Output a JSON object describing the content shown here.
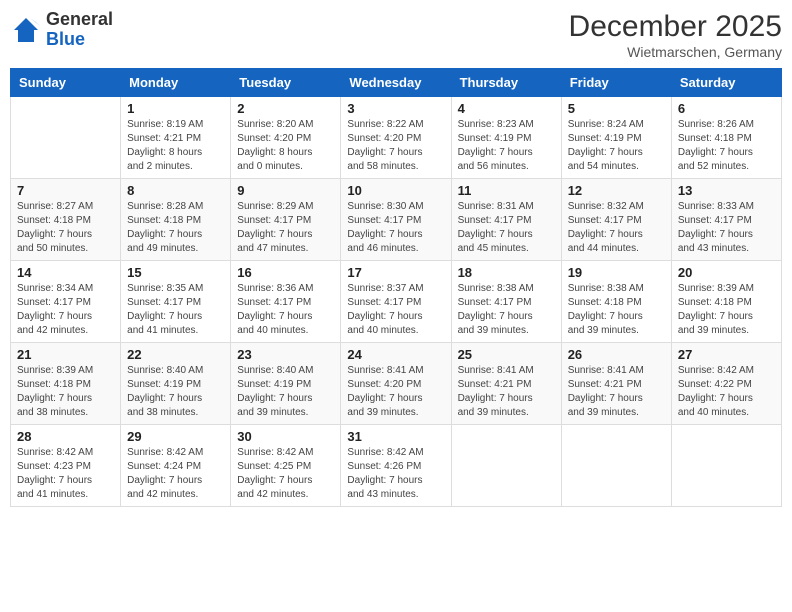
{
  "logo": {
    "general": "General",
    "blue": "Blue"
  },
  "header": {
    "month_year": "December 2025",
    "location": "Wietmarschen, Germany"
  },
  "days_of_week": [
    "Sunday",
    "Monday",
    "Tuesday",
    "Wednesday",
    "Thursday",
    "Friday",
    "Saturday"
  ],
  "weeks": [
    [
      {
        "day": "",
        "info": ""
      },
      {
        "day": "1",
        "info": "Sunrise: 8:19 AM\nSunset: 4:21 PM\nDaylight: 8 hours\nand 2 minutes."
      },
      {
        "day": "2",
        "info": "Sunrise: 8:20 AM\nSunset: 4:20 PM\nDaylight: 8 hours\nand 0 minutes."
      },
      {
        "day": "3",
        "info": "Sunrise: 8:22 AM\nSunset: 4:20 PM\nDaylight: 7 hours\nand 58 minutes."
      },
      {
        "day": "4",
        "info": "Sunrise: 8:23 AM\nSunset: 4:19 PM\nDaylight: 7 hours\nand 56 minutes."
      },
      {
        "day": "5",
        "info": "Sunrise: 8:24 AM\nSunset: 4:19 PM\nDaylight: 7 hours\nand 54 minutes."
      },
      {
        "day": "6",
        "info": "Sunrise: 8:26 AM\nSunset: 4:18 PM\nDaylight: 7 hours\nand 52 minutes."
      }
    ],
    [
      {
        "day": "7",
        "info": "Sunrise: 8:27 AM\nSunset: 4:18 PM\nDaylight: 7 hours\nand 50 minutes."
      },
      {
        "day": "8",
        "info": "Sunrise: 8:28 AM\nSunset: 4:18 PM\nDaylight: 7 hours\nand 49 minutes."
      },
      {
        "day": "9",
        "info": "Sunrise: 8:29 AM\nSunset: 4:17 PM\nDaylight: 7 hours\nand 47 minutes."
      },
      {
        "day": "10",
        "info": "Sunrise: 8:30 AM\nSunset: 4:17 PM\nDaylight: 7 hours\nand 46 minutes."
      },
      {
        "day": "11",
        "info": "Sunrise: 8:31 AM\nSunset: 4:17 PM\nDaylight: 7 hours\nand 45 minutes."
      },
      {
        "day": "12",
        "info": "Sunrise: 8:32 AM\nSunset: 4:17 PM\nDaylight: 7 hours\nand 44 minutes."
      },
      {
        "day": "13",
        "info": "Sunrise: 8:33 AM\nSunset: 4:17 PM\nDaylight: 7 hours\nand 43 minutes."
      }
    ],
    [
      {
        "day": "14",
        "info": "Sunrise: 8:34 AM\nSunset: 4:17 PM\nDaylight: 7 hours\nand 42 minutes."
      },
      {
        "day": "15",
        "info": "Sunrise: 8:35 AM\nSunset: 4:17 PM\nDaylight: 7 hours\nand 41 minutes."
      },
      {
        "day": "16",
        "info": "Sunrise: 8:36 AM\nSunset: 4:17 PM\nDaylight: 7 hours\nand 40 minutes."
      },
      {
        "day": "17",
        "info": "Sunrise: 8:37 AM\nSunset: 4:17 PM\nDaylight: 7 hours\nand 40 minutes."
      },
      {
        "day": "18",
        "info": "Sunrise: 8:38 AM\nSunset: 4:17 PM\nDaylight: 7 hours\nand 39 minutes."
      },
      {
        "day": "19",
        "info": "Sunrise: 8:38 AM\nSunset: 4:18 PM\nDaylight: 7 hours\nand 39 minutes."
      },
      {
        "day": "20",
        "info": "Sunrise: 8:39 AM\nSunset: 4:18 PM\nDaylight: 7 hours\nand 39 minutes."
      }
    ],
    [
      {
        "day": "21",
        "info": "Sunrise: 8:39 AM\nSunset: 4:18 PM\nDaylight: 7 hours\nand 38 minutes."
      },
      {
        "day": "22",
        "info": "Sunrise: 8:40 AM\nSunset: 4:19 PM\nDaylight: 7 hours\nand 38 minutes."
      },
      {
        "day": "23",
        "info": "Sunrise: 8:40 AM\nSunset: 4:19 PM\nDaylight: 7 hours\nand 39 minutes."
      },
      {
        "day": "24",
        "info": "Sunrise: 8:41 AM\nSunset: 4:20 PM\nDaylight: 7 hours\nand 39 minutes."
      },
      {
        "day": "25",
        "info": "Sunrise: 8:41 AM\nSunset: 4:21 PM\nDaylight: 7 hours\nand 39 minutes."
      },
      {
        "day": "26",
        "info": "Sunrise: 8:41 AM\nSunset: 4:21 PM\nDaylight: 7 hours\nand 39 minutes."
      },
      {
        "day": "27",
        "info": "Sunrise: 8:42 AM\nSunset: 4:22 PM\nDaylight: 7 hours\nand 40 minutes."
      }
    ],
    [
      {
        "day": "28",
        "info": "Sunrise: 8:42 AM\nSunset: 4:23 PM\nDaylight: 7 hours\nand 41 minutes."
      },
      {
        "day": "29",
        "info": "Sunrise: 8:42 AM\nSunset: 4:24 PM\nDaylight: 7 hours\nand 42 minutes."
      },
      {
        "day": "30",
        "info": "Sunrise: 8:42 AM\nSunset: 4:25 PM\nDaylight: 7 hours\nand 42 minutes."
      },
      {
        "day": "31",
        "info": "Sunrise: 8:42 AM\nSunset: 4:26 PM\nDaylight: 7 hours\nand 43 minutes."
      },
      {
        "day": "",
        "info": ""
      },
      {
        "day": "",
        "info": ""
      },
      {
        "day": "",
        "info": ""
      }
    ]
  ]
}
